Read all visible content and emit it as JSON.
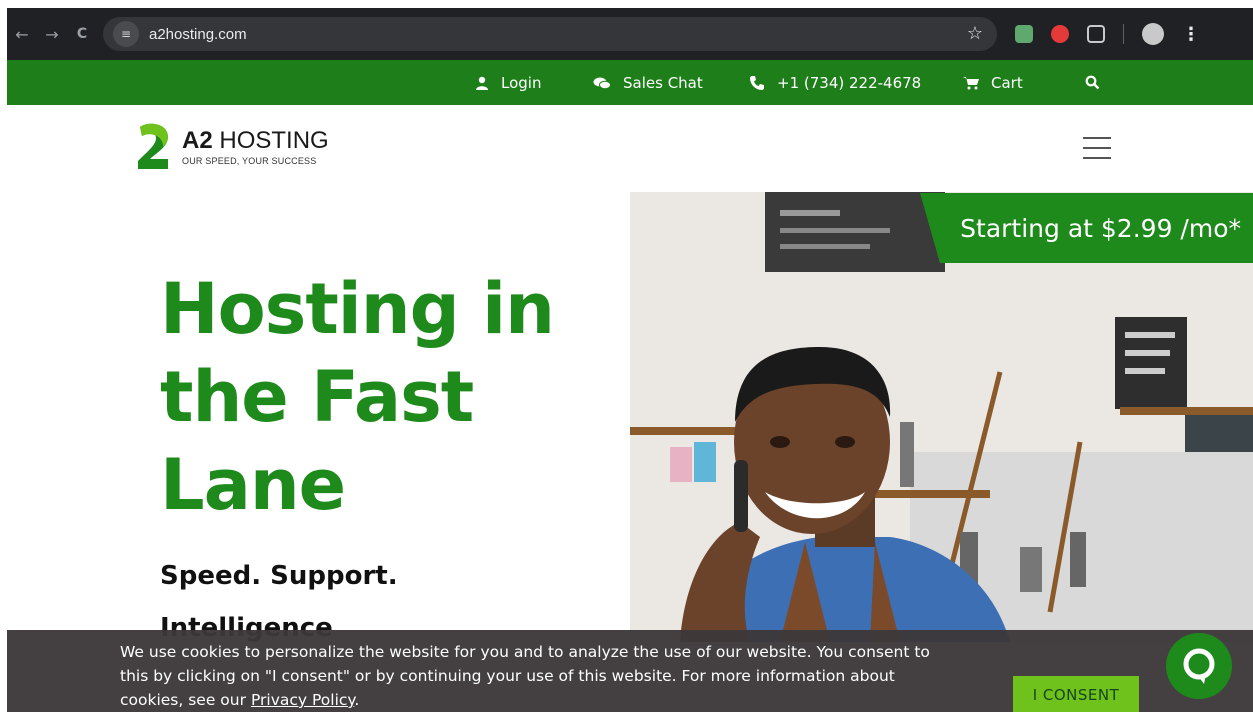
{
  "browser": {
    "url": "a2hosting.com",
    "back_icon": "←",
    "forward_icon": "→",
    "reload_icon": "C",
    "site_info_icon": "≡",
    "bookmark_icon": "☆",
    "menu_icon": "⋮"
  },
  "utility_bar": {
    "items": [
      {
        "label": "Login",
        "icon": "user-icon"
      },
      {
        "label": "Sales Chat",
        "icon": "chat-icon"
      },
      {
        "label": "+1 (734) 222-4678",
        "icon": "phone-icon"
      },
      {
        "label": "Cart",
        "icon": "cart-icon"
      }
    ],
    "search_icon": "search-icon",
    "background": "#1e7e1a"
  },
  "header": {
    "logo_bold": "A2",
    "logo_rest": "HOSTING",
    "logo_tagline": "OUR SPEED, YOUR SUCCESS"
  },
  "hero": {
    "title_line1": "Hosting in",
    "title_line2": "the Fast",
    "title_line3": "Lane",
    "subtitle_line1": "Speed. Support.",
    "subtitle_line2": "Intelligence",
    "price_badge": "Starting at $2.99 /mo*",
    "accent": "#1e8a1c"
  },
  "cookie_banner": {
    "text_before_link": "We use cookies to personalize the website for you and to analyze the use of our website. You consent to this by clicking on \"I consent\" or by continuing your use of this website. For more information about cookies, see our",
    "link_text": "Privacy Policy",
    "text_after_link": ".",
    "consent_button": "I CONSENT"
  }
}
